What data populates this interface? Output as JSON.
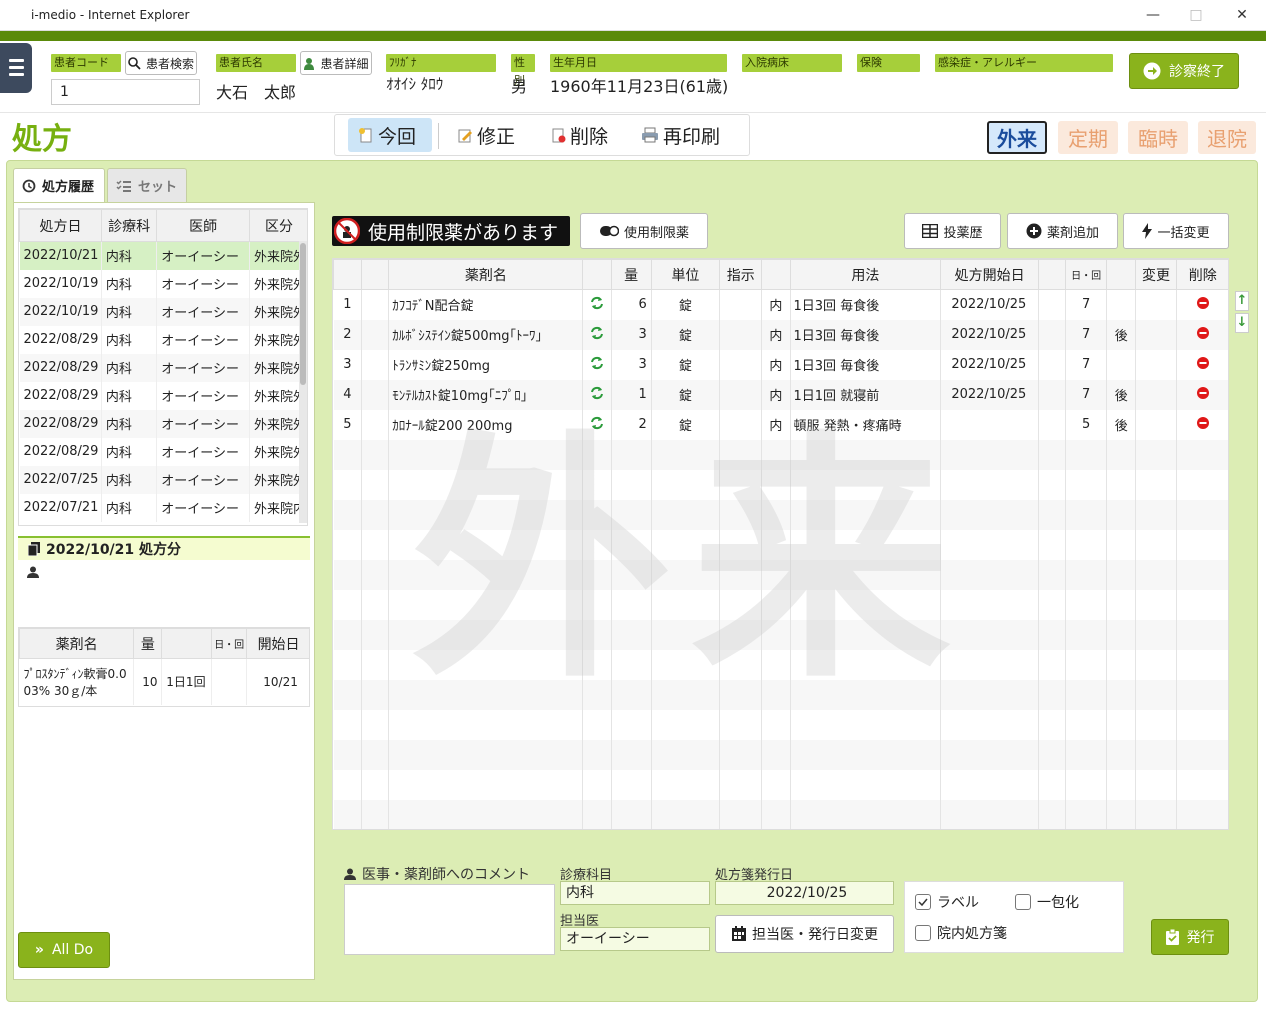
{
  "window": {
    "title": "i-medio - Internet Explorer"
  },
  "header": {
    "patient_code_label": "患者コード",
    "patient_search": "患者検索",
    "patient_code_value": "1",
    "patient_name_label": "患者氏名",
    "patient_detail": "患者詳細",
    "patient_name": "大石　太郎",
    "kana_label": "ﾌﾘｶﾞﾅ",
    "kana": "ｵｵｲｼ ﾀﾛｳ",
    "sex_label": "性別",
    "sex": "男",
    "dob_label": "生年月日",
    "dob": "1960年11月23日(61歳)",
    "ward_label": "入院病床",
    "insurance_label": "保険",
    "allergy_label": "感染症・アレルギー",
    "end_button": "診察終了"
  },
  "page_title": "処方",
  "toolbar": {
    "current": "今回",
    "edit": "修正",
    "delete": "削除",
    "reprint": "再印刷"
  },
  "modes": {
    "outpatient": "外来",
    "regular": "定期",
    "temporary": "臨時",
    "discharge": "退院"
  },
  "colors": {
    "accent": "#8ab31c",
    "header_label": "#a6cf3a",
    "delete_red": "#e01818"
  },
  "left": {
    "tab_history": "処方履歴",
    "tab_set": "セット",
    "history_headers": [
      "処方日",
      "診療科",
      "医師",
      "区分"
    ],
    "history_rows": [
      [
        "2022/10/21",
        "内科",
        "オーイーシー",
        "外来院外"
      ],
      [
        "2022/10/19",
        "内科",
        "オーイーシー",
        "外来院外"
      ],
      [
        "2022/10/19",
        "内科",
        "オーイーシー",
        "外来院外"
      ],
      [
        "2022/08/29",
        "内科",
        "オーイーシー",
        "外来院外"
      ],
      [
        "2022/08/29",
        "内科",
        "オーイーシー",
        "外来院外"
      ],
      [
        "2022/08/29",
        "内科",
        "オーイーシー",
        "外来院外"
      ],
      [
        "2022/08/29",
        "内科",
        "オーイーシー",
        "外来院外"
      ],
      [
        "2022/08/29",
        "内科",
        "オーイーシー",
        "外来院外"
      ],
      [
        "2022/07/25",
        "内科",
        "オーイーシー",
        "外来院外"
      ],
      [
        "2022/07/21",
        "内科",
        "オーイーシー",
        "外来院内"
      ]
    ],
    "detail_title": "2022/10/21 処方分",
    "detail_headers": [
      "薬剤名",
      "量",
      "",
      "日・回",
      "開始日"
    ],
    "detail_rows": [
      [
        "ﾌﾟﾛｽﾀﾝﾃﾞｨﾝ軟膏0.003% 30ｇ/本",
        "10",
        "1日1回",
        "",
        "10/21"
      ]
    ],
    "all_do": "All Do"
  },
  "main": {
    "restricted_banner": "使用制限薬があります",
    "restricted_button": "使用制限薬",
    "history_button": "投薬歴",
    "add_button": "薬剤追加",
    "bulk_button": "一括変更",
    "headers": [
      "",
      "",
      "薬剤名",
      "",
      "量",
      "単位",
      "指示",
      "",
      "用法",
      "処方開始日",
      "",
      "日・回",
      "",
      "変更",
      "削除"
    ],
    "rows": [
      {
        "no": "1",
        "name": "ｶﾌｺﾃﾞN配合錠",
        "qty": "6",
        "unit": "錠",
        "type": "内",
        "usage": "1日3回 毎食後",
        "start": "2022/10/25",
        "days": "7",
        "after": "",
        "change": ""
      },
      {
        "no": "2",
        "name": "ｶﾙﾎﾞｼｽﾃｲﾝ錠500mg｢ﾄｰﾜ｣",
        "qty": "3",
        "unit": "錠",
        "type": "内",
        "usage": "1日3回 毎食後",
        "start": "2022/10/25",
        "days": "7",
        "after": "後",
        "change": ""
      },
      {
        "no": "3",
        "name": "ﾄﾗﾝｻﾐﾝ錠250mg",
        "qty": "3",
        "unit": "錠",
        "type": "内",
        "usage": "1日3回 毎食後",
        "start": "2022/10/25",
        "days": "7",
        "after": "",
        "change": ""
      },
      {
        "no": "4",
        "name": "ﾓﾝﾃﾙｶｽﾄ錠10mg｢ﾆﾌﾟﾛ｣",
        "qty": "1",
        "unit": "錠",
        "type": "内",
        "usage": "1日1回 就寝前",
        "start": "2022/10/25",
        "days": "7",
        "after": "後",
        "change": ""
      },
      {
        "no": "5",
        "name": "ｶﾛﾅｰﾙ錠200 200mg",
        "qty": "2",
        "unit": "錠",
        "type": "内",
        "usage": "頓服 発熱・疼痛時",
        "start": "",
        "days": "5",
        "after": "後",
        "change": ""
      }
    ]
  },
  "footer": {
    "comment_label": "医事・薬剤師へのコメント",
    "dept_label": "診療科目",
    "dept": "内科",
    "doctor_label": "担当医",
    "doctor": "オーイーシー",
    "issue_date_label": "処方箋発行日",
    "issue_date": "2022/10/25",
    "change_button": "担当医・発行日変更",
    "label_check": "ラベル",
    "pack_check": "一包化",
    "inhouse_check": "院内処方箋",
    "issue_button": "発行"
  },
  "watermark": "外来"
}
